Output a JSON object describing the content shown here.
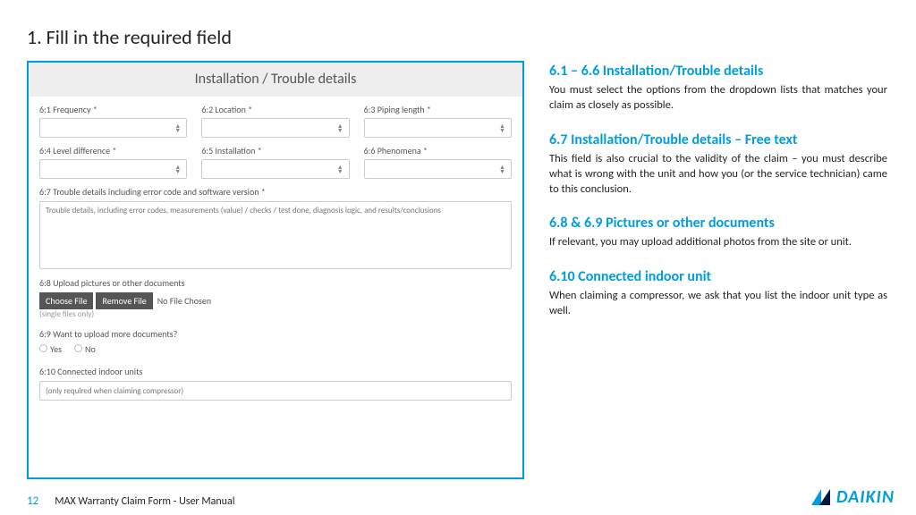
{
  "page": {
    "title": "1. Fill in the required field",
    "number": "12",
    "footer": "MAX Warranty Claim Form - User Manual",
    "logo": "DAIKIN"
  },
  "form": {
    "header": "Installation / Trouble details",
    "f61": "6:1 Frequency *",
    "f62": "6:2 Location *",
    "f63": "6:3 Piping length *",
    "f64": "6:4 Level difference *",
    "f65": "6:5 Installation *",
    "f66": "6:6 Phenomena *",
    "f67": "6:7 Trouble details including error code and software version *",
    "f67ph": "Trouble details, including error codes, measurements (value) / checks / test done, diagnosis logic, and results/conclusions",
    "f68": "6:8 Upload pictures or other documents",
    "choose": "Choose File",
    "remove": "Remove File",
    "nofile": "No File Chosen",
    "single": "(single files only)",
    "f69": "6:9 Want to upload more documents?",
    "yes": "Yes",
    "no": "No",
    "f610": "6:10 Connected indoor units",
    "f610ph": "(only required when claiming compressor)"
  },
  "side": {
    "h1": "6.1 – 6.6 Installation/Trouble details",
    "p1": "You must select the options from the dropdown lists that matches your claim as closely as possible.",
    "h2": "6.7 Installation/Trouble details – Free text",
    "p2": "This field is also crucial to the validity of the claim – you must describe what is wrong with the unit and how you (or the service technician) came to this conclusion.",
    "h3": "6.8 & 6.9 Pictures or other documents",
    "p3": "If relevant, you may upload additional photos from the site or unit.",
    "h4": "6.10 Connected indoor unit",
    "p4": "When claiming a compressor, we ask that you list the indoor unit type as well."
  }
}
